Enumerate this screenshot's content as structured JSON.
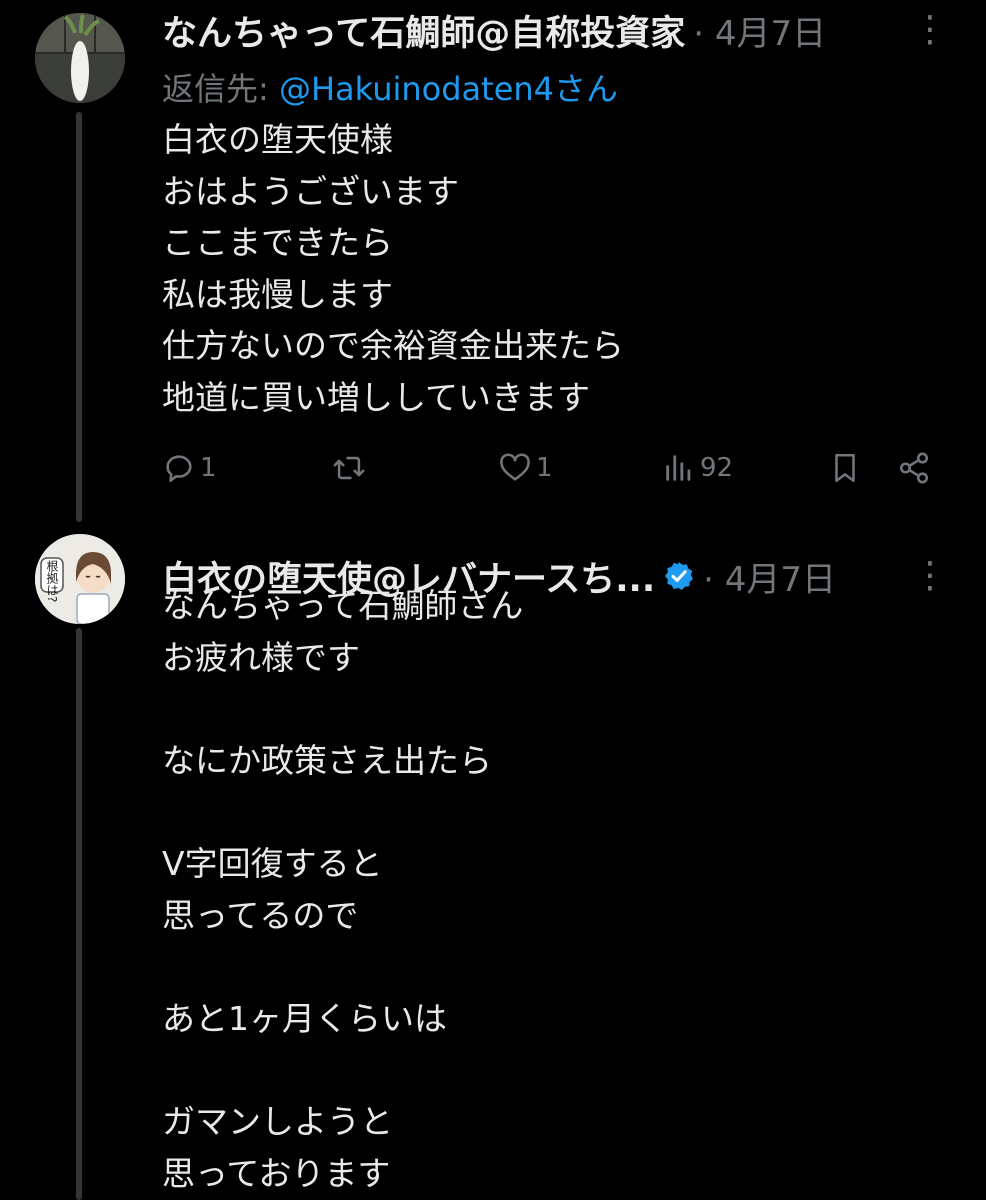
{
  "tweets": [
    {
      "author": "なんちゃって石鯛師@自称投資家",
      "date": "· 4月7日",
      "reply_prefix": "返信先: ",
      "reply_handle": "@Hakuinodaten4さん",
      "text": "白衣の堕天使様\nおはようございます\nここまできたら\n私は我慢します\n仕方ないので余裕資金出来たら\n地道に買い増ししていきます",
      "actions": {
        "replies": "1",
        "retweets": "",
        "likes": "1",
        "views": "92"
      },
      "icons": [
        "reply-icon",
        "retweet-icon",
        "like-icon",
        "views-icon",
        "bookmark-icon",
        "share-icon"
      ]
    },
    {
      "author": "白衣の堕天使@レバナースち...",
      "verified": true,
      "date": "· 4月7日",
      "avatar_text": "根拠は?",
      "text": "なんちゃって石鯛師さん\nお疲れ様です\n\nなにか政策さえ出たら\n\nV字回復すると\n思ってるので\n\nあと1ヶ月くらいは\n\nガマンしようと\n思っております"
    }
  ],
  "colors": {
    "background": "#000000",
    "text": "#e7e9ea",
    "muted": "#71767b",
    "accent": "#1d9bf0"
  }
}
